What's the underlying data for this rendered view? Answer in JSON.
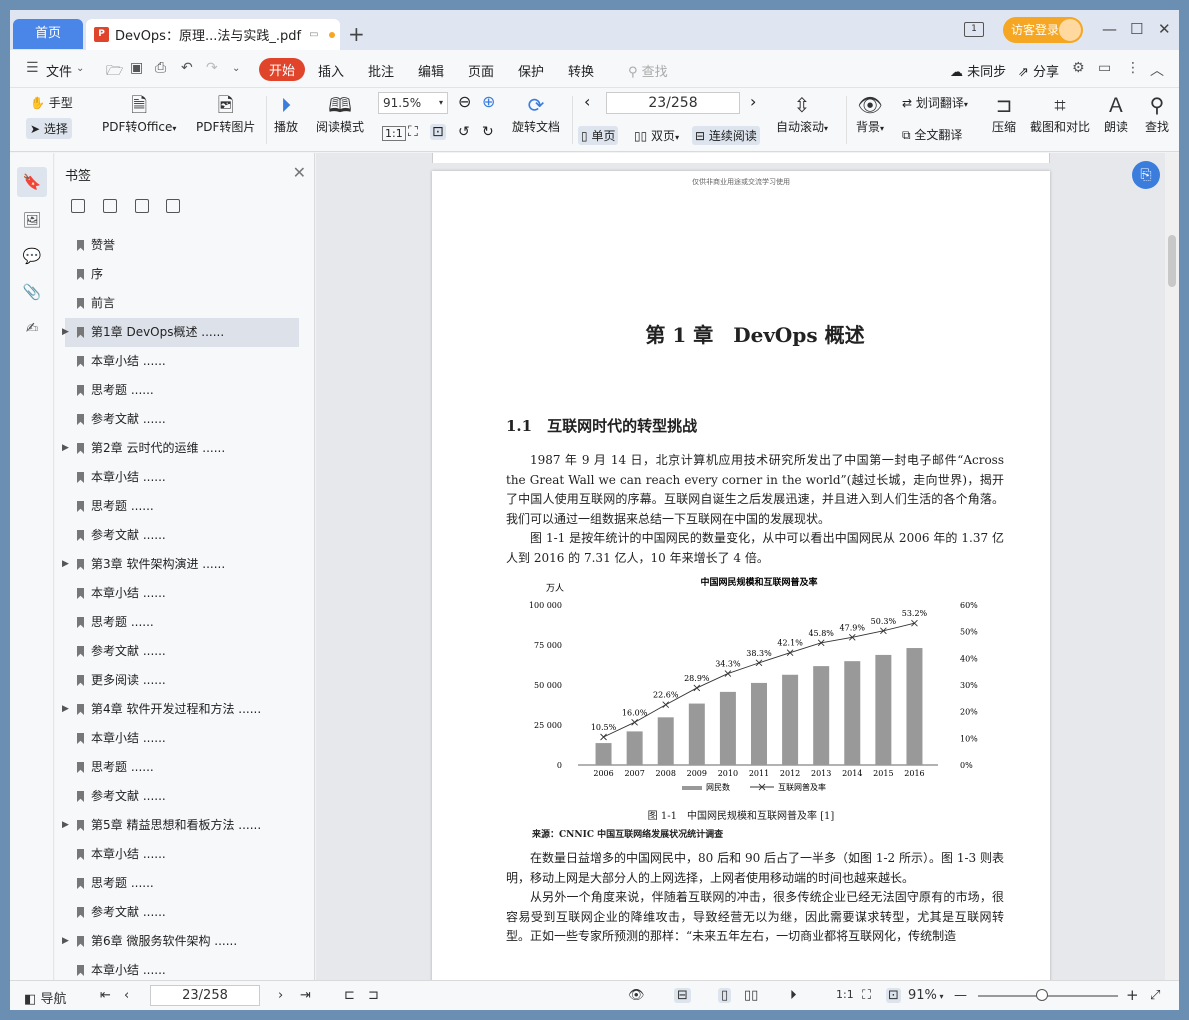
{
  "tabs": {
    "home": "首页",
    "doc_title": "DevOps：原理...法与实践_.pdf",
    "doc_icon": "P",
    "new_tab": "+"
  },
  "titlebar": {
    "page_indicator": "1",
    "visitor": "访客登录"
  },
  "menu": {
    "file": "文件",
    "start": "开始",
    "insert": "插入",
    "annotate": "批注",
    "edit": "编辑",
    "page": "页面",
    "protect": "保护",
    "convert": "转换",
    "search_placeholder": "查找",
    "unsynced": "未同步",
    "share": "分享"
  },
  "toolbar": {
    "hand": "手型",
    "select": "选择",
    "pdf_to_office": "PDF转Office",
    "pdf_to_image": "PDF转图片",
    "play": "播放",
    "read_mode": "阅读模式",
    "zoom": "91.5%",
    "rotate_doc": "旋转文档",
    "page_num": "23/258",
    "single_page": "单页",
    "double_page": "双页",
    "continuous": "连续阅读",
    "auto_scroll": "自动滚动",
    "background": "背景",
    "word_translate": "划词翻译",
    "full_translate": "全文翻译",
    "compress": "压缩",
    "crop_compare": "截图和对比",
    "read_aloud": "朗读",
    "find": "查找"
  },
  "bookmarks": {
    "title": "书签",
    "items": [
      {
        "label": "赞誉",
        "expandable": false,
        "selected": false
      },
      {
        "label": "序",
        "expandable": false,
        "selected": false
      },
      {
        "label": "前言",
        "expandable": false,
        "selected": false
      },
      {
        "label": "第1章 DevOps概述 ......",
        "expandable": true,
        "selected": true
      },
      {
        "label": "本章小结 ......",
        "expandable": false,
        "selected": false
      },
      {
        "label": "思考题 ......",
        "expandable": false,
        "selected": false
      },
      {
        "label": "参考文献 ......",
        "expandable": false,
        "selected": false
      },
      {
        "label": "第2章 云时代的运维 ......",
        "expandable": true,
        "selected": false
      },
      {
        "label": "本章小结 ......",
        "expandable": false,
        "selected": false
      },
      {
        "label": "思考题 ......",
        "expandable": false,
        "selected": false
      },
      {
        "label": "参考文献 ......",
        "expandable": false,
        "selected": false
      },
      {
        "label": "第3章 软件架构演进 ......",
        "expandable": true,
        "selected": false
      },
      {
        "label": "本章小结 ......",
        "expandable": false,
        "selected": false
      },
      {
        "label": "思考题 ......",
        "expandable": false,
        "selected": false
      },
      {
        "label": "参考文献 ......",
        "expandable": false,
        "selected": false
      },
      {
        "label": "更多阅读 ......",
        "expandable": false,
        "selected": false
      },
      {
        "label": "第4章 软件开发过程和方法 ......",
        "expandable": true,
        "selected": false
      },
      {
        "label": "本章小结 ......",
        "expandable": false,
        "selected": false
      },
      {
        "label": "思考题 ......",
        "expandable": false,
        "selected": false
      },
      {
        "label": "参考文献 ......",
        "expandable": false,
        "selected": false
      },
      {
        "label": "第5章 精益思想和看板方法 ......",
        "expandable": true,
        "selected": false
      },
      {
        "label": "本章小结 ......",
        "expandable": false,
        "selected": false
      },
      {
        "label": "思考题 ......",
        "expandable": false,
        "selected": false
      },
      {
        "label": "参考文献 ......",
        "expandable": false,
        "selected": false
      },
      {
        "label": "第6章 微服务软件架构 ......",
        "expandable": true,
        "selected": false
      },
      {
        "label": "本章小结 ......",
        "expandable": false,
        "selected": false
      }
    ]
  },
  "page": {
    "watermark": "仅供非商业用途或交流学习使用",
    "chapter_title": "第 1 章　DevOps 概述",
    "section_title": "1.1　互联网时代的转型挑战",
    "para1": "1987 年 9 月 14 日，北京计算机应用技术研究所发出了中国第一封电子邮件“Across the Great Wall we can reach every corner in the world”(越过长城，走向世界)，揭开了中国人使用互联网的序幕。互联网自诞生之后发展迅速，并且进入到人们生活的各个角落。我们可以通过一组数据来总结一下互联网在中国的发展现状。",
    "para2": "图 1-1 是按年统计的中国网民的数量变化，从中可以看出中国网民从 2006 年的 1.37 亿人到 2016 的 7.31 亿人，10 年来增长了 4 倍。",
    "caption": "图 1-1　中国网民规模和互联网普及率 [1]",
    "source": "来源：CNNIC 中国互联网络发展状况统计调查",
    "para3": "在数量日益增多的中国网民中，80 后和 90 后占了一半多（如图 1-2 所示）。图 1-3 则表明，移动上网是大部分人的上网选择，上网者使用移动端的时间也越来越长。",
    "para4": "从另外一个角度来说，伴随着互联网的冲击，很多传统企业已经无法固守原有的市场，很容易受到互联网企业的降维攻击，导致经营无以为继，因此需要谋求转型，尤其是互联网转型。正如一些专家所预测的那样：“未来五年左右，一切商业都将互联网化，传统制造"
  },
  "chart_data": {
    "type": "bar",
    "title": "中国网民规模和互联网普及率",
    "ylabel": "万人",
    "categories": [
      "2006",
      "2007",
      "2008",
      "2009",
      "2010",
      "2011",
      "2012",
      "2013",
      "2014",
      "2015",
      "2016"
    ],
    "ylim": [
      0,
      100000
    ],
    "y_ticks": [
      "0",
      "25 000",
      "50 000",
      "75 000",
      "100 000"
    ],
    "y2lim": [
      0,
      60
    ],
    "y2_ticks": [
      "0%",
      "10%",
      "20%",
      "30%",
      "40%",
      "50%",
      "60%"
    ],
    "series": [
      {
        "name": "网民数",
        "type": "bar",
        "values": [
          13700,
          21000,
          29800,
          38400,
          45700,
          51300,
          56400,
          61800,
          64900,
          68800,
          73100
        ]
      },
      {
        "name": "互联网普及率",
        "type": "line",
        "values": [
          10.5,
          16.0,
          22.6,
          28.9,
          34.3,
          38.3,
          42.1,
          45.8,
          47.9,
          50.3,
          53.2
        ],
        "labels": [
          "10.5%",
          "16.0%",
          "22.6%",
          "28.9%",
          "34.3%",
          "38.3%",
          "42.1%",
          "45.8%",
          "47.9%",
          "50.3%",
          "53.2%"
        ]
      }
    ],
    "colors": {
      "bar": "#999999",
      "line": "#333333"
    }
  },
  "statusbar": {
    "nav": "导航",
    "page_num": "23/258",
    "zoom": "91%"
  }
}
